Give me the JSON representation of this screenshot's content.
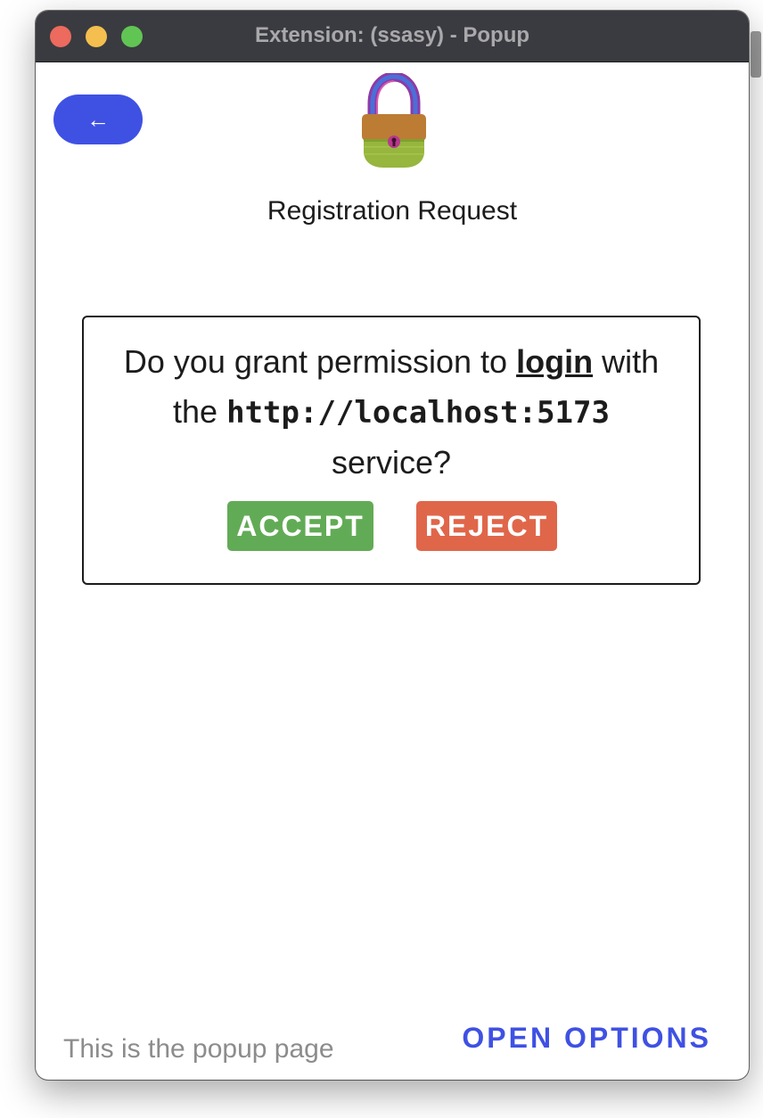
{
  "window": {
    "title": "Extension: (ssasy) - Popup"
  },
  "header": {
    "back_icon": "arrow-left-icon",
    "back_glyph": "←",
    "logo_icon": "padlock-icon",
    "title": "Registration Request"
  },
  "request": {
    "prefix": "Do you grant permission to",
    "action": "login",
    "middle_1": "with",
    "middle_2": "the",
    "service": "http://localhost:5173",
    "suffix": "service?",
    "accept_label": "ACCEPT",
    "reject_label": "REJECT"
  },
  "footer": {
    "text": "This is the popup page",
    "options_label": "OPEN OPTIONS"
  },
  "colors": {
    "accent": "#3f51e3",
    "accept": "#62ab56",
    "reject": "#e0664a",
    "titlebar": "#3a3b40"
  }
}
